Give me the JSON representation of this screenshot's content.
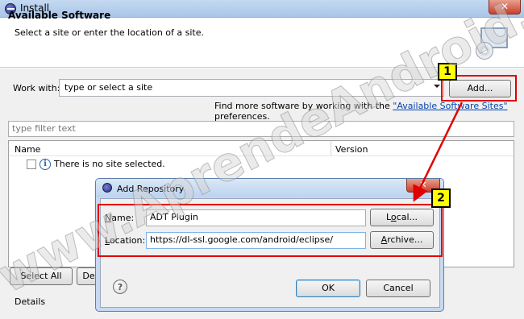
{
  "window": {
    "title": "Install",
    "close_glyph": "✕"
  },
  "header": {
    "title": "Available Software",
    "subtitle": "Select a site or enter the location of a site."
  },
  "workwith": {
    "label": "Work with:",
    "value": "type or select a site",
    "add_button": "Add..."
  },
  "findmore": {
    "prefix": "Find more software by working with the ",
    "link": "\"Available Software Sites\"",
    "suffix": " preferences."
  },
  "filter": {
    "placeholder": "type filter text"
  },
  "table": {
    "columns": [
      "Name",
      "Version"
    ],
    "rows": [
      {
        "checked": false,
        "icon": "info-icon",
        "text": "There is no site selected."
      }
    ]
  },
  "buttons": {
    "select_all": "Select All",
    "deselect_all_partial": "De"
  },
  "details_label": "Details",
  "dialog": {
    "title": "Add Repository",
    "close_glyph": "✕",
    "name_label_accel": "N",
    "name_label_rest": "ame:",
    "name_value": "ADT Plugin",
    "local_button_pre": "L",
    "local_button_accel": "o",
    "local_button_post": "cal...",
    "location_label_accel": "L",
    "location_label_rest": "ocation:",
    "location_value": "https://dl-ssl.google.com/android/eclipse/",
    "archive_button_accel": "A",
    "archive_button_rest": "rchive...",
    "help_glyph": "?",
    "ok_button": "OK",
    "cancel_button": "Cancel"
  },
  "annotations": {
    "step1": "1",
    "step2": "2",
    "arrow_color": "#e00000"
  },
  "watermark": "www.AprendeAndroid.com",
  "colors": {
    "title_gradient": "#b8d0ee",
    "link": "#0645ad",
    "highlight": "#ffff00",
    "annotation_red": "#e00000"
  }
}
